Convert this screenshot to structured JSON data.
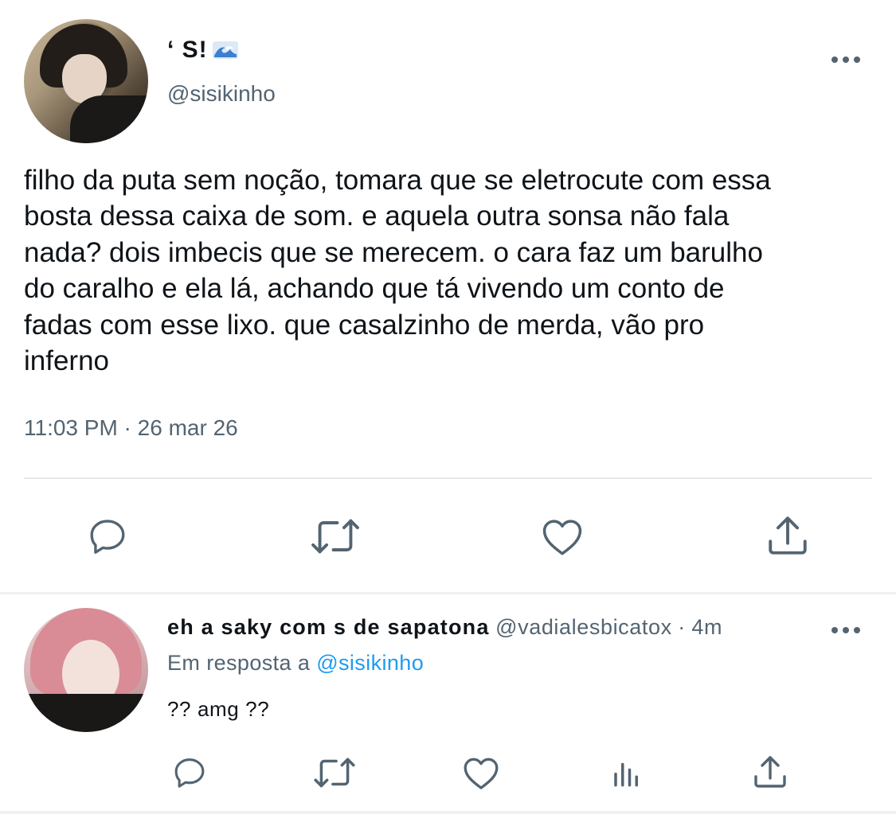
{
  "tweet": {
    "display_name": "‘ S!",
    "name_emoji": "water-wave-emoji",
    "handle": "@sisikinho",
    "text_lines": [
      "filho da puta sem noção, tomara que se eletrocute com essa",
      "bosta dessa caixa de som. e aquela outra sonsa não fala",
      "nada? dois imbecis que se merecem. o cara faz um barulho",
      "do caralho e ela lá, achando que tá vivendo um conto de",
      "fadas com esse lixo. que casalzinho de merda, vão pro",
      "inferno"
    ],
    "timestamp": "11:03 PM · 26 mar 26",
    "actions": [
      "reply-icon",
      "retweet-icon",
      "like-icon",
      "share-icon"
    ]
  },
  "reply": {
    "display_name": "eh a saky com s de sapatona",
    "handle": "@vadialesbicatox",
    "separator": "·",
    "time": "4m",
    "replying_to_prefix": "Em resposta a",
    "replying_to_handle": "@sisikinho",
    "text": "?? amg ??",
    "actions": [
      "reply-icon",
      "retweet-icon",
      "like-icon",
      "analytics-icon",
      "share-icon"
    ]
  },
  "colors": {
    "text_primary": "#0f1419",
    "text_secondary": "#536471",
    "link": "#1d9bf0",
    "divider": "#e6e9ea"
  }
}
